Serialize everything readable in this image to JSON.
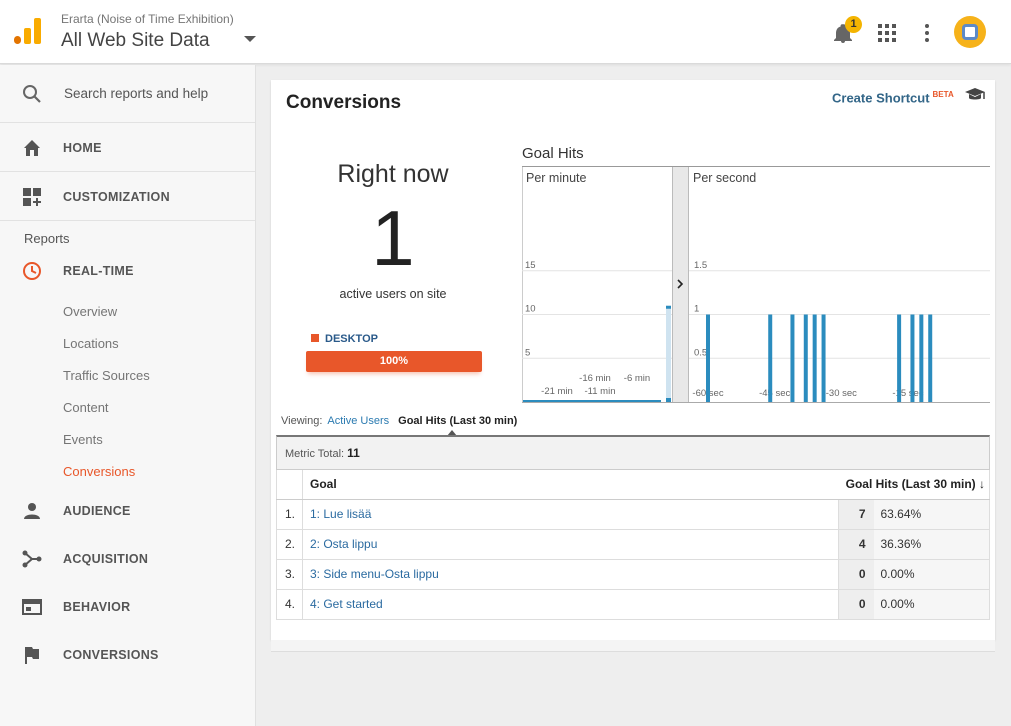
{
  "header": {
    "account_sub": "Erarta (Noise of Time Exhibition)",
    "account_view": "All Web Site Data",
    "notifications_count": "1"
  },
  "sidebar": {
    "search_placeholder": "Search reports and help",
    "home_label": "HOME",
    "customization_label": "CUSTOMIZATION",
    "reports_header": "Reports",
    "realtime_label": "REAL-TIME",
    "realtime_items": [
      "Overview",
      "Locations",
      "Traffic Sources",
      "Content",
      "Events",
      "Conversions"
    ],
    "audience_label": "AUDIENCE",
    "acquisition_label": "ACQUISITION",
    "behavior_label": "BEHAVIOR",
    "conversions_label": "CONVERSIONS"
  },
  "card": {
    "title": "Conversions",
    "shortcut_label": "Create Shortcut",
    "beta_label": "BETA"
  },
  "rightnow": {
    "heading": "Right now",
    "active_users": "1",
    "active_label": "active users on site",
    "device_label": "DESKTOP",
    "device_pct_label": "100%"
  },
  "chart_data": {
    "type": "bar",
    "title": "Goal Hits",
    "panels": [
      {
        "name": "Per minute",
        "yticks": [
          5,
          10,
          15
        ],
        "x_tick_labels": [
          "-21 min",
          "-16 min",
          "-11 min",
          "-6 min"
        ],
        "ylim": [
          0,
          20
        ],
        "values_note": "",
        "last_minute_value": 11
      },
      {
        "name": "Per second",
        "yticks": [
          0.5,
          1,
          1.5
        ],
        "x_tick_labels": [
          "-60 sec",
          "-45 sec",
          "-30 sec",
          "-15 sec"
        ],
        "ylim": [
          0,
          2
        ],
        "hits_seconds_ago": [
          -60,
          -46,
          -41,
          -38,
          -36,
          -34,
          -17,
          -14,
          -12,
          -10
        ],
        "hit_value": 1
      }
    ],
    "bar_color": "#2b8cbe"
  },
  "viewing": {
    "label": "Viewing:",
    "option_active_users": "Active Users",
    "option_goal_hits": "Goal Hits (Last 30 min)"
  },
  "metric": {
    "label": "Metric Total:",
    "value": "11"
  },
  "table": {
    "col_goal": "Goal",
    "col_hits": "Goal Hits (Last 30 min)",
    "sort_icon": "↓",
    "rows": [
      {
        "num": "1.",
        "goal": "1: Lue lisää",
        "hits": "7",
        "pct": "63.64%"
      },
      {
        "num": "2.",
        "goal": "2: Osta lippu",
        "hits": "4",
        "pct": "36.36%"
      },
      {
        "num": "3.",
        "goal": "3: Side menu-Osta lippu",
        "hits": "0",
        "pct": "0.00%"
      },
      {
        "num": "4.",
        "goal": "4: Get started",
        "hits": "0",
        "pct": "0.00%"
      }
    ]
  },
  "colors": {
    "accent": "#e8572a",
    "link": "#2a6aa0",
    "bar": "#2b8cbe"
  }
}
